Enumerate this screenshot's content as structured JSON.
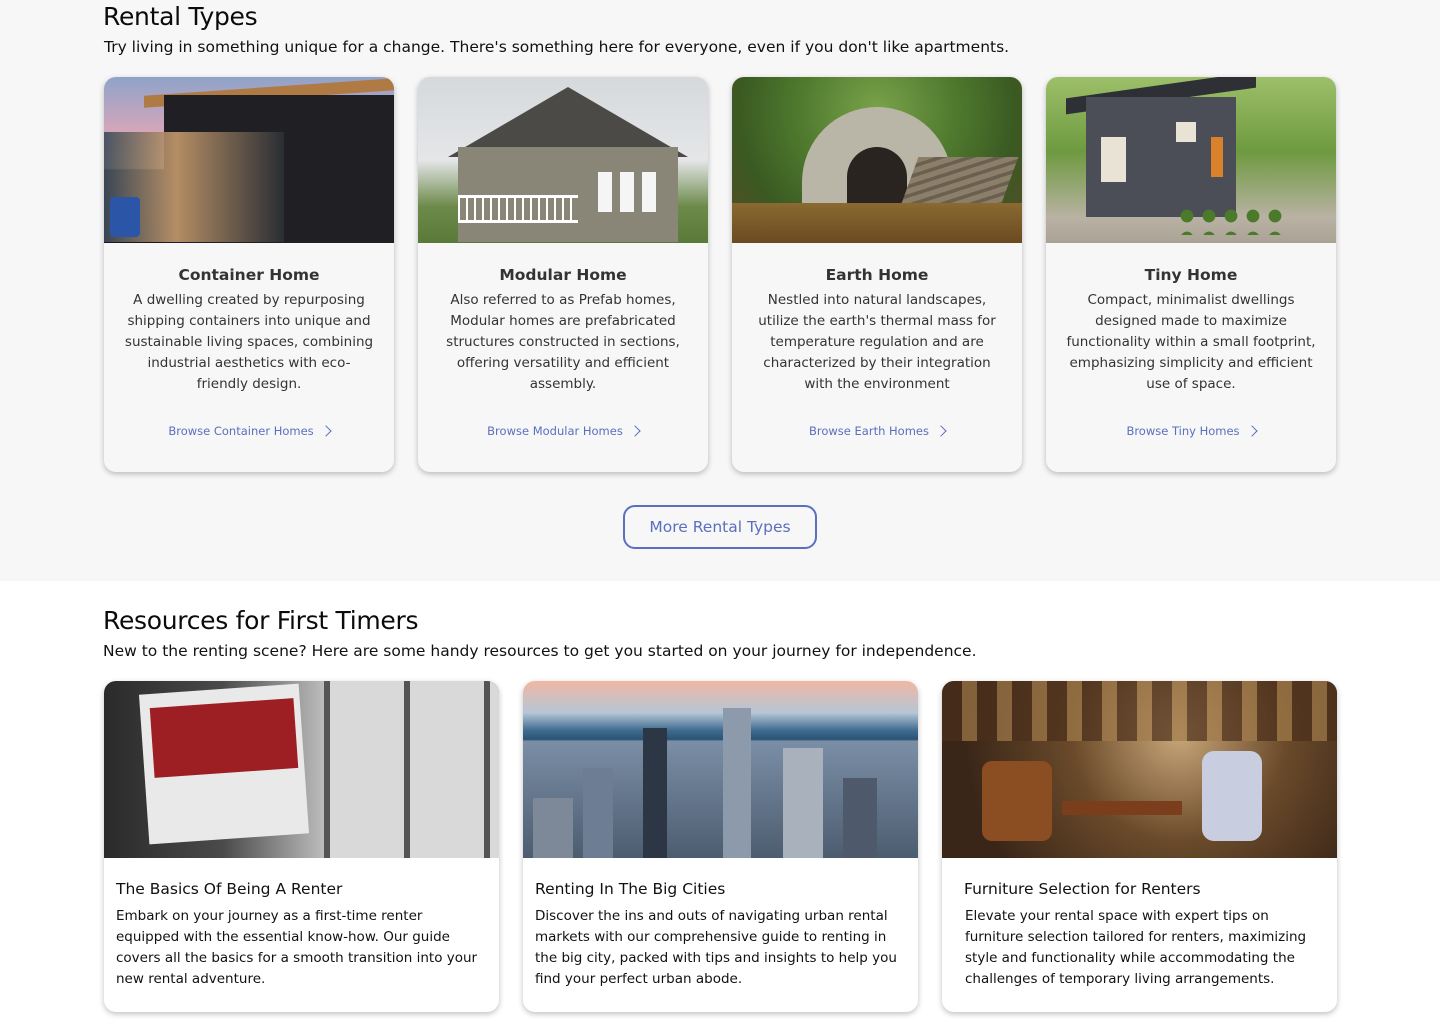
{
  "rental_section": {
    "title": "Rental Types",
    "subtitle": "Try living in something unique for a change. There's something here for everyone, even if you don't like apartments.",
    "cards": [
      {
        "title": "Container Home",
        "description": "A dwelling created by repurposing shipping containers into unique and sustainable living spaces, combining industrial aesthetics with eco-friendly design.",
        "link": "Browse Container Homes"
      },
      {
        "title": "Modular Home",
        "description": "Also referred to as Prefab homes, Modular homes are prefabricated structures constructed in sections, offering versatility and efficient assembly.",
        "link": "Browse Modular Homes"
      },
      {
        "title": "Earth Home",
        "description": "Nestled into natural landscapes, utilize the earth's thermal mass for temperature regulation and are characterized by their integration with the environment",
        "link": "Browse Earth Homes"
      },
      {
        "title": "Tiny Home",
        "description": "Compact, minimalist dwellings designed made to maximize functionality within a small footprint, emphasizing simplicity and efficient use of space.",
        "link": "Browse Tiny Homes"
      }
    ],
    "more_button": "More Rental Types"
  },
  "resources_section": {
    "title": "Resources for First Timers",
    "subtitle": "New to the renting scene? Here are some handy resources to get you started on your journey for independence.",
    "cards": [
      {
        "title": "The Basics Of Being A Renter",
        "description": "Embark on your journey as a first-time renter equipped with the essential know-how. Our guide covers all the basics for a smooth transition into your new rental adventure."
      },
      {
        "title": "Renting In The Big Cities",
        "description": "Discover the ins and outs of navigating urban rental markets with our comprehensive guide to renting in the big city, packed with tips and insights to help you find your perfect urban abode."
      },
      {
        "title": "Furniture Selection for Renters",
        "description": "Elevate your rental space with expert tips on furniture selection tailored for renters, maximizing style and functionality while accommodating the challenges of temporary living arrangements."
      }
    ]
  },
  "colors": {
    "accent": "#5a6fc0",
    "section_bg": "#f7f7f7"
  },
  "icons": {
    "link_arrow": "chevron-right-icon"
  }
}
